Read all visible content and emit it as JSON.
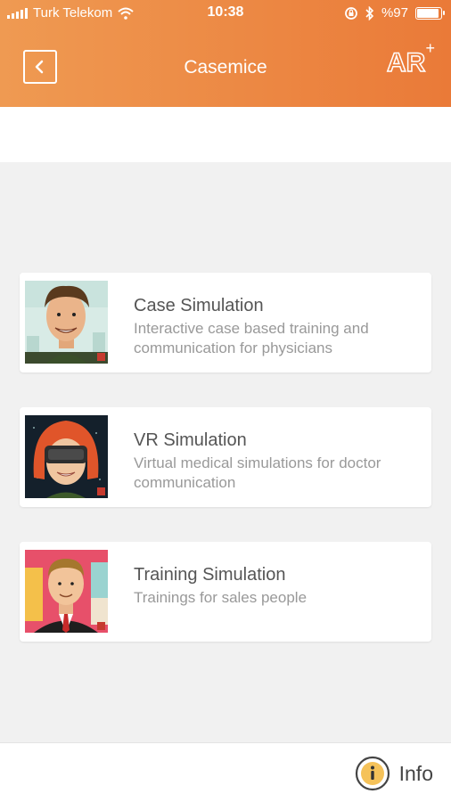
{
  "status_bar": {
    "carrier": "Turk Telekom",
    "time": "10:38",
    "battery": "%97",
    "battery_level": 0.97
  },
  "header": {
    "title": "Casemice",
    "ar_label": "AR",
    "ar_plus": "+"
  },
  "cards": [
    {
      "title": "Case Simulation",
      "description": "Interactive case based training and communication for physicians"
    },
    {
      "title": "VR Simulation",
      "description": "Virtual medical simulations for doctor communication"
    },
    {
      "title": "Training Simulation",
      "description": "Trainings for sales people"
    }
  ],
  "footer": {
    "info_label": "Info"
  },
  "colors": {
    "header_start": "#ef9a52",
    "header_end": "#ea7a38",
    "background": "#f1f1f1"
  }
}
